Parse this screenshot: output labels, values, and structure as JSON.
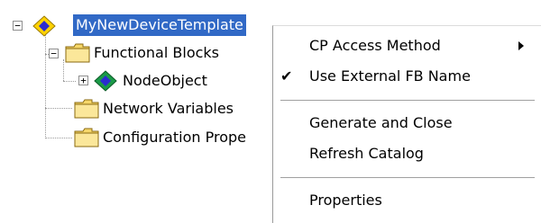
{
  "tree": {
    "root": {
      "label": "MyNewDeviceTemplate",
      "expander": "−"
    },
    "functional_blocks": {
      "label": "Functional Blocks",
      "expander": "−"
    },
    "node_object": {
      "label": "NodeObject",
      "expander": "+"
    },
    "network_variables": {
      "label": "Network Variables"
    },
    "configuration_properties": {
      "label": "Configuration Prope"
    }
  },
  "context_menu": {
    "cp_access_method": "CP Access Method",
    "use_external_fb_name": "Use External FB Name",
    "use_external_fb_name_check": "✔",
    "generate_and_close": "Generate and Close",
    "refresh_catalog": "Refresh Catalog",
    "properties": "Properties"
  },
  "colors": {
    "selection": "#3169c6",
    "folder": "#f6d76a",
    "diamond_root": "#ffd200",
    "diamond_node": "#1a9a48"
  },
  "icons": {
    "root": "diamond-device-icon",
    "folder": "folder-icon",
    "node": "diamond-node-icon",
    "submenu": "submenu-arrow-icon",
    "check": "check-icon"
  }
}
